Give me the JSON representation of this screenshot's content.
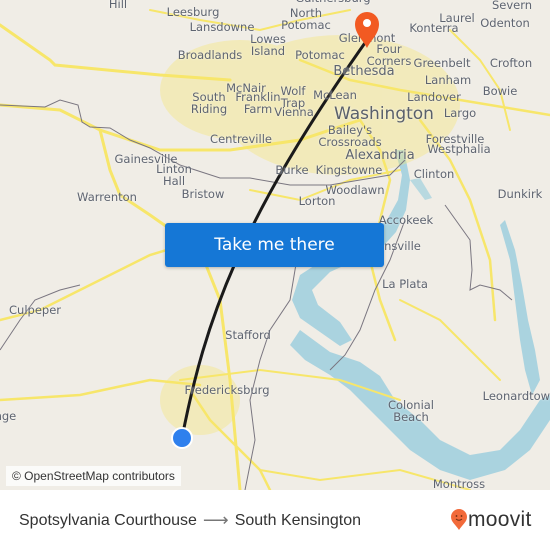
{
  "map": {
    "places": [
      {
        "name": "Round Hill",
        "label": "Round\nHill",
        "size": "small"
      },
      {
        "name": "Leesburg",
        "label": "Leesburg",
        "size": "small"
      },
      {
        "name": "Lansdowne",
        "label": "Lansdowne",
        "size": "small"
      },
      {
        "name": "Gaithersburg",
        "label": "Gaithersburg",
        "size": "small"
      },
      {
        "name": "North Potomac",
        "label": "North\nPotomac",
        "size": "small"
      },
      {
        "name": "Lowes Island",
        "label": "Lowes\nIsland",
        "size": "small"
      },
      {
        "name": "Broadlands",
        "label": "Broadlands",
        "size": "small"
      },
      {
        "name": "Potomac",
        "label": "Potomac",
        "size": "small"
      },
      {
        "name": "Laurel",
        "label": "Laurel",
        "size": "small"
      },
      {
        "name": "Konterra",
        "label": "Konterra",
        "size": "small"
      },
      {
        "name": "Severn",
        "label": "Severn",
        "size": "small"
      },
      {
        "name": "Odenton",
        "label": "Odenton",
        "size": "small"
      },
      {
        "name": "Glenmont",
        "label": "Glenmont",
        "size": "small"
      },
      {
        "name": "Four Corners",
        "label": "Four\nCorners",
        "size": "small"
      },
      {
        "name": "Greenbelt",
        "label": "Greenbelt",
        "size": "small"
      },
      {
        "name": "Crofton",
        "label": "Crofton",
        "size": "small"
      },
      {
        "name": "Bethesda",
        "label": "Bethesda",
        "size": "medium"
      },
      {
        "name": "McNair",
        "label": "McNair",
        "size": "small"
      },
      {
        "name": "Franklin Farm",
        "label": "Franklin\nFarm",
        "size": "small"
      },
      {
        "name": "South Riding",
        "label": "South\nRiding",
        "size": "small"
      },
      {
        "name": "Wolf Trap",
        "label": "Wolf\nTrap",
        "size": "small"
      },
      {
        "name": "McLean",
        "label": "McLean",
        "size": "small"
      },
      {
        "name": "Vienna",
        "label": "Vienna",
        "size": "small"
      },
      {
        "name": "Lanham",
        "label": "Lanham",
        "size": "small"
      },
      {
        "name": "Landover",
        "label": "Landover",
        "size": "small"
      },
      {
        "name": "Bowie",
        "label": "Bowie",
        "size": "small"
      },
      {
        "name": "Washington",
        "label": "Washington",
        "size": "large"
      },
      {
        "name": "Largo",
        "label": "Largo",
        "size": "small"
      },
      {
        "name": "Centreville",
        "label": "Centreville",
        "size": "small"
      },
      {
        "name": "Bailey's Crossroads",
        "label": "Bailey's\nCrossroads",
        "size": "small"
      },
      {
        "name": "Forestville",
        "label": "Forestville",
        "size": "small"
      },
      {
        "name": "Westphalia",
        "label": "Westphalia",
        "size": "small"
      },
      {
        "name": "Alexandria",
        "label": "Alexandria",
        "size": "medium"
      },
      {
        "name": "Gainesville",
        "label": "Gainesville",
        "size": "small"
      },
      {
        "name": "Linton Hall",
        "label": "Linton\nHall",
        "size": "small"
      },
      {
        "name": "Bristow",
        "label": "Bristow",
        "size": "small"
      },
      {
        "name": "Burke",
        "label": "Burke",
        "size": "small"
      },
      {
        "name": "Kingstowne",
        "label": "Kingstowne",
        "size": "small"
      },
      {
        "name": "Clinton",
        "label": "Clinton",
        "size": "small"
      },
      {
        "name": "Warrenton",
        "label": "Warrenton",
        "size": "small"
      },
      {
        "name": "Woodlawn",
        "label": "Woodlawn",
        "size": "small"
      },
      {
        "name": "Dunkirk",
        "label": "Dunkirk",
        "size": "small"
      },
      {
        "name": "Lorton",
        "label": "Lorton",
        "size": "small"
      },
      {
        "name": "Accokeek",
        "label": "Accokeek",
        "size": "small"
      },
      {
        "name": "Bensville",
        "label": "Bensville",
        "size": "small"
      },
      {
        "name": "La Plata",
        "label": "La Plata",
        "size": "small"
      },
      {
        "name": "Culpeper",
        "label": "Culpeper",
        "size": "small"
      },
      {
        "name": "Stafford",
        "label": "Stafford",
        "size": "small"
      },
      {
        "name": "Fredericksburg",
        "label": "Fredericksburg",
        "size": "small"
      },
      {
        "name": "Leonardtown",
        "label": "Leonardtown",
        "size": "small"
      },
      {
        "name": "Colonial Beach",
        "label": "Colonial\nBeach",
        "size": "small"
      },
      {
        "name": "Orange",
        "label": "Orange",
        "size": "small"
      },
      {
        "name": "Montross",
        "label": "Montross",
        "size": "small"
      }
    ],
    "origin": {
      "name": "Spotsylvania Courthouse",
      "marker_icon": "blue-dot-icon"
    },
    "destination": {
      "name": "South Kensington",
      "marker_icon": "map-pin-icon"
    },
    "cta_label": "Take me there",
    "attribution": "© OpenStreetMap contributors"
  },
  "footer": {
    "from": "Spotsylvania Courthouse",
    "to": "South Kensington",
    "arrow_icon": "arrow-right-icon",
    "brand": "moovit"
  },
  "colors": {
    "land": "#f0ede6",
    "water": "#aad3df",
    "road": "#f7e66a",
    "route_line": "#1a1a1a",
    "origin_marker": "#2f80ed",
    "destination_marker": "#f25a22",
    "cta_bg": "#1577d6",
    "brand_orange": "#f26a3a"
  }
}
